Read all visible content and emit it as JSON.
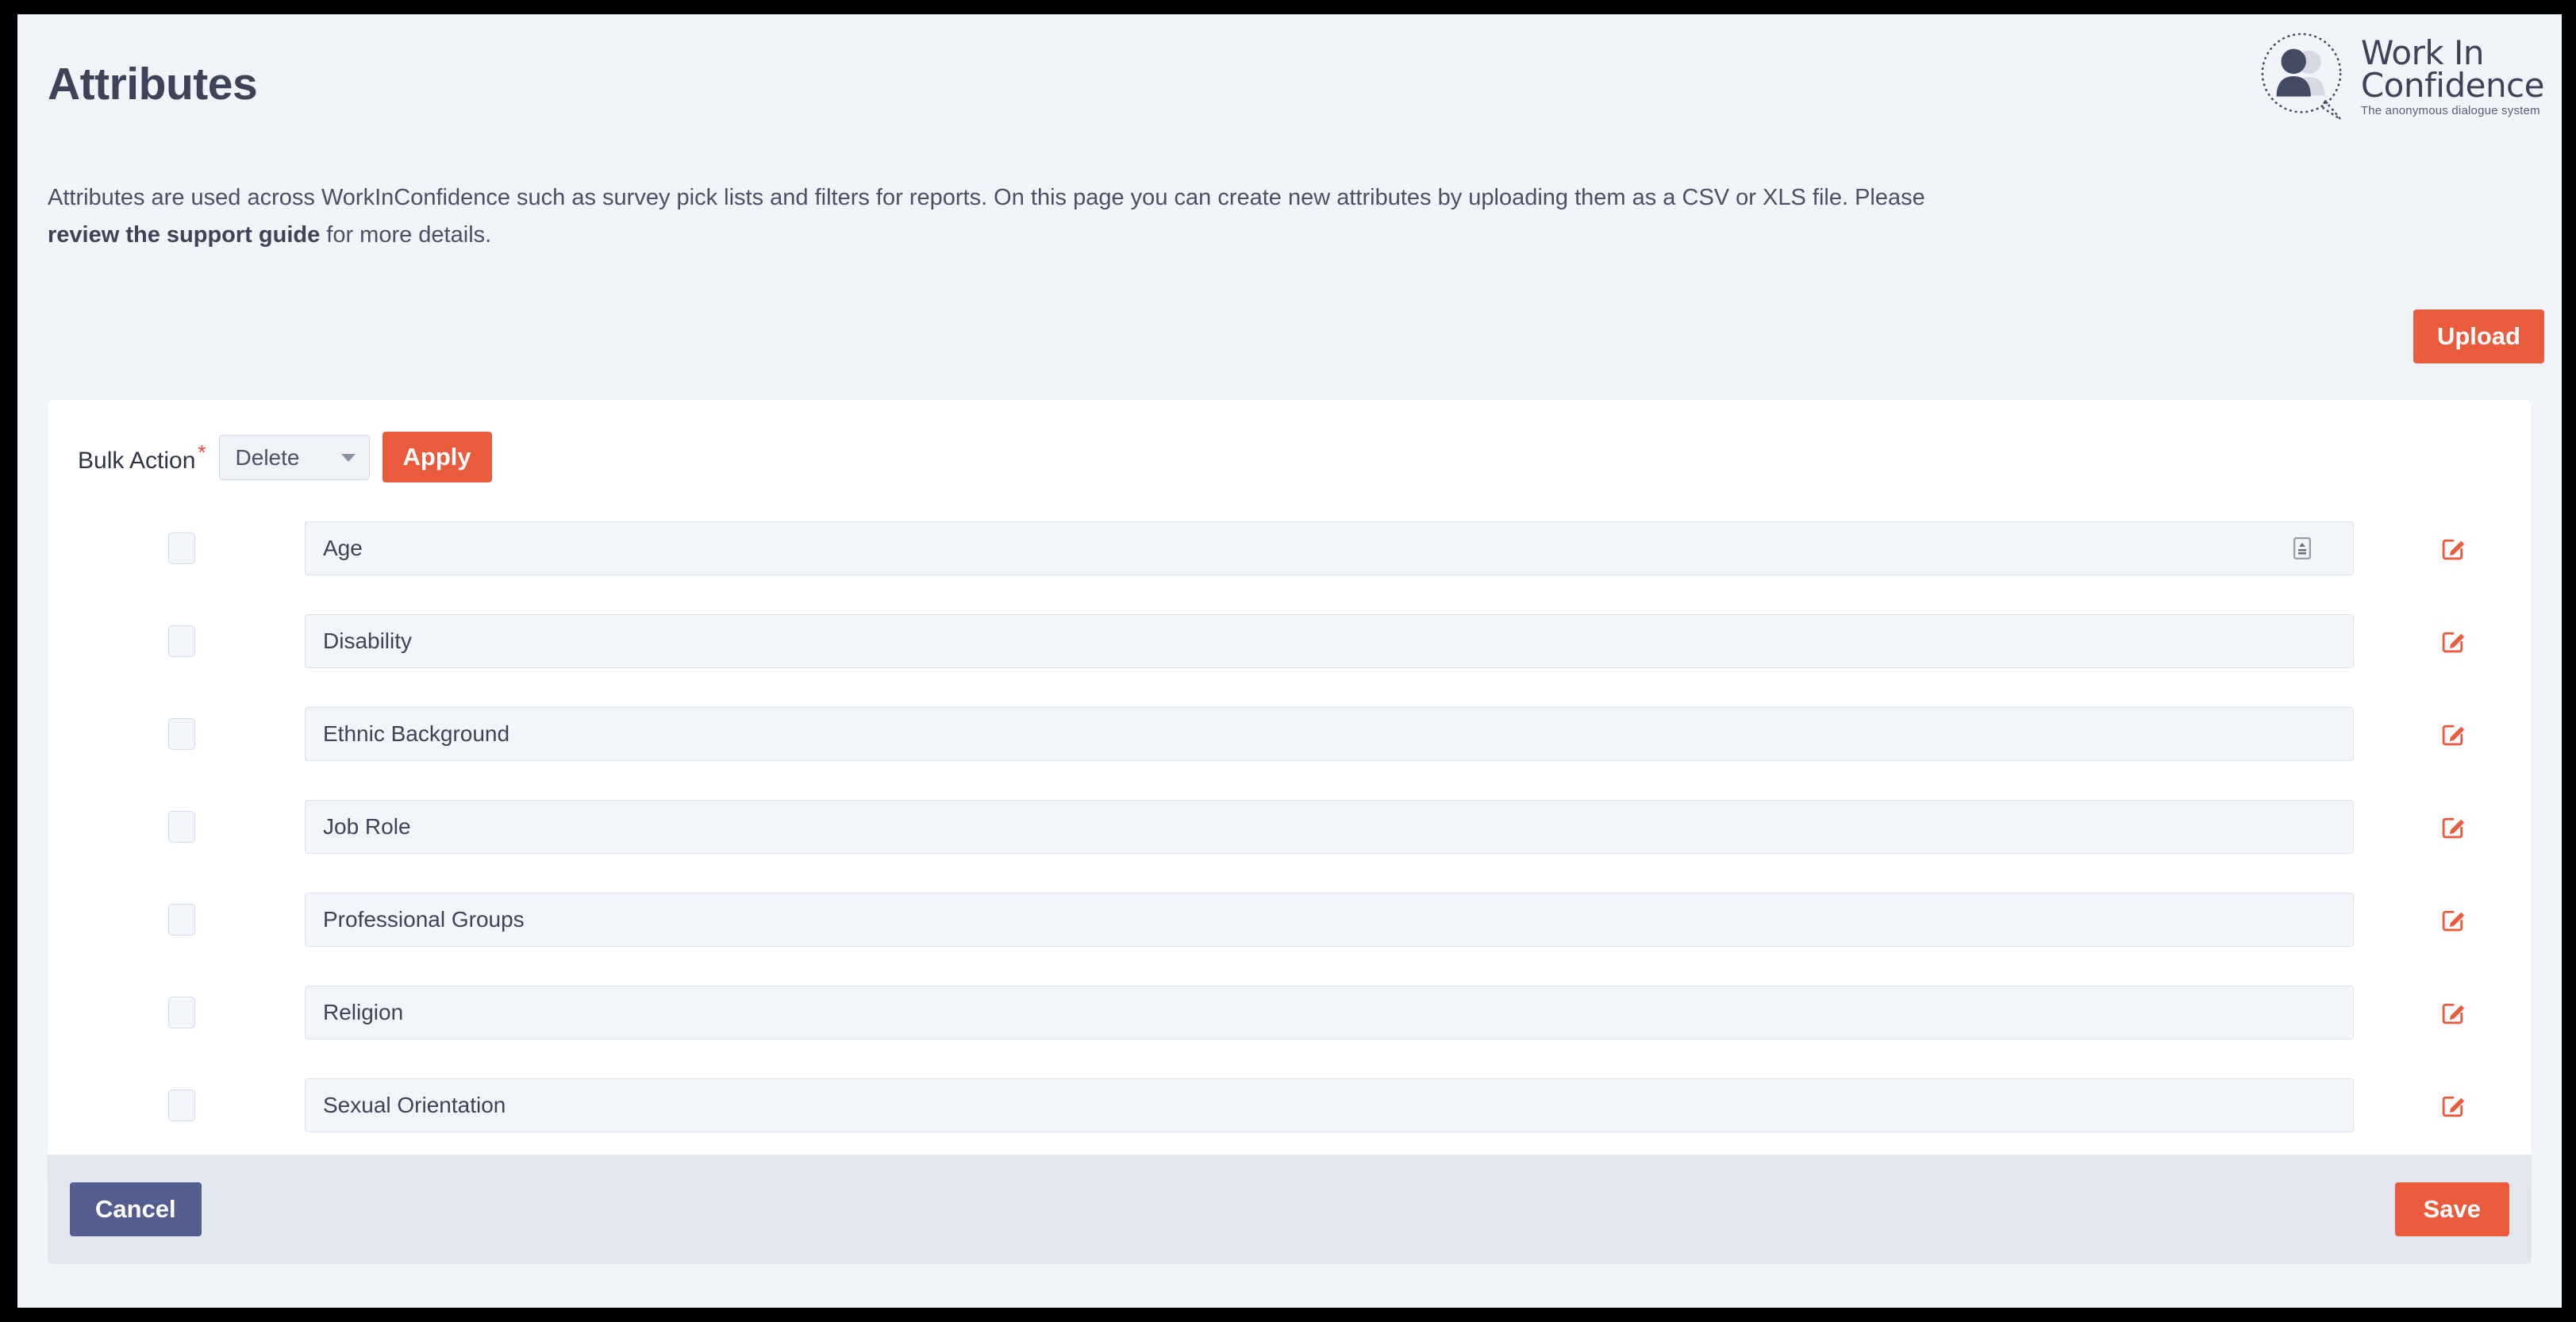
{
  "page": {
    "title": "Attributes",
    "description_part1": "Attributes are used across WorkInConfidence such as survey pick lists and filters for reports. On this page you can create new attributes by uploading them as a CSV or XLS file. Please ",
    "description_link": "review the support guide",
    "description_part2": " for more details.",
    "background_color": "#f1f4f9"
  },
  "logo": {
    "line1": "Work In",
    "line2": "Confidence",
    "tagline": "The anonymous dialogue system",
    "mark_name": "two-people-in-speech-bubble",
    "color_dark": "#434a63",
    "color_light": "#d7dae3"
  },
  "toolbar": {
    "upload_label": "Upload",
    "upload_color": "#ea5b3e"
  },
  "bulk_action": {
    "label": "Bulk Action",
    "required_marker": "*",
    "selected_option": "Delete",
    "options": [
      "Delete"
    ],
    "apply_label": "Apply",
    "apply_color": "#ea5b3e"
  },
  "attributes": [
    {
      "name": "Age",
      "checked": false,
      "has_autofill_icon": true,
      "edit_icon": "edit-pencil-square-icon"
    },
    {
      "name": "Disability",
      "checked": false,
      "has_autofill_icon": false,
      "edit_icon": "edit-pencil-square-icon"
    },
    {
      "name": "Ethnic Background",
      "checked": false,
      "has_autofill_icon": false,
      "edit_icon": "edit-pencil-square-icon"
    },
    {
      "name": "Job Role",
      "checked": false,
      "has_autofill_icon": false,
      "edit_icon": "edit-pencil-square-icon"
    },
    {
      "name": "Professional Groups",
      "checked": false,
      "has_autofill_icon": false,
      "edit_icon": "edit-pencil-square-icon"
    },
    {
      "name": "Religion",
      "checked": false,
      "has_autofill_icon": false,
      "edit_icon": "edit-pencil-square-icon"
    },
    {
      "name": "Sexual Orientation",
      "checked": false,
      "has_autofill_icon": false,
      "edit_icon": "edit-pencil-square-icon"
    }
  ],
  "footer": {
    "cancel_label": "Cancel",
    "cancel_color": "#545d8f",
    "save_label": "Save",
    "save_color": "#ea5b3e"
  }
}
